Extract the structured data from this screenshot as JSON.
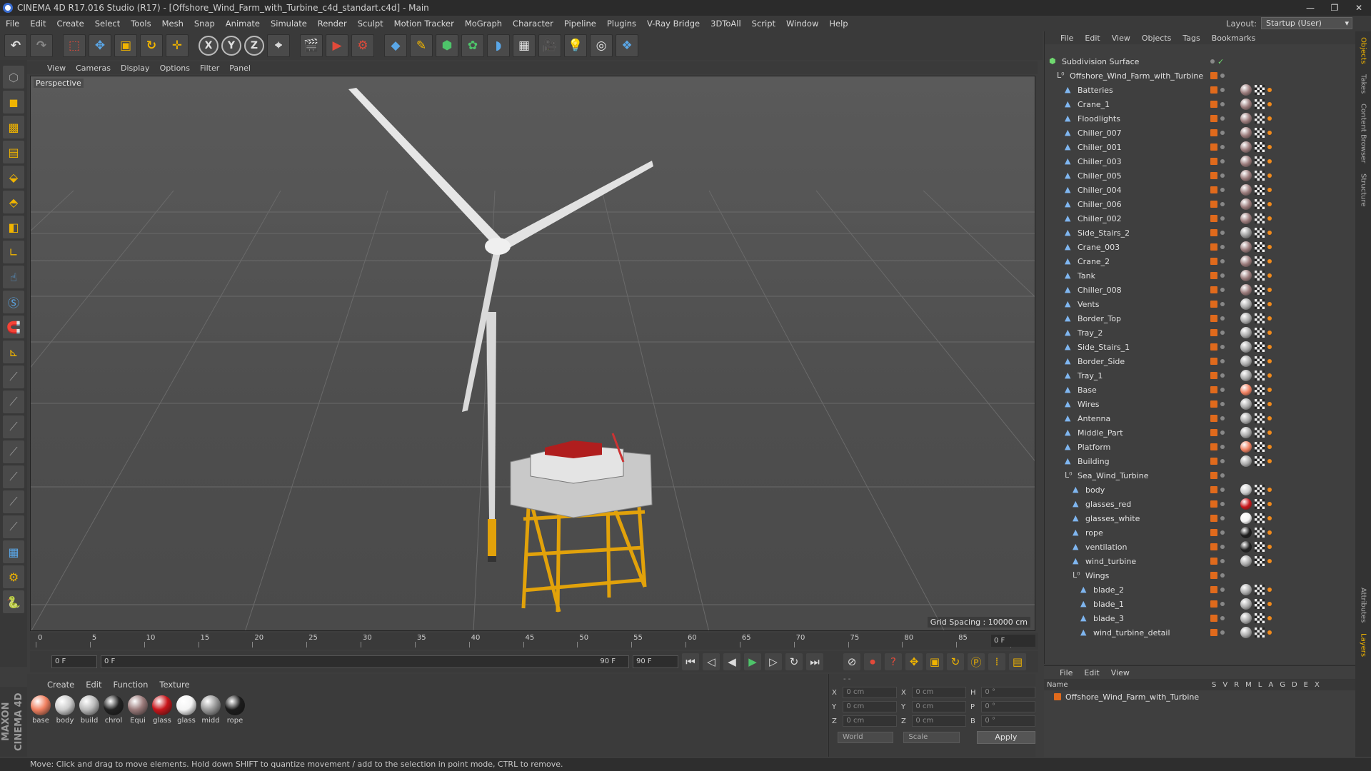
{
  "window": {
    "title": "CINEMA 4D R17.016 Studio (R17) - [Offshore_Wind_Farm_with_Turbine_c4d_standart.c4d] - Main",
    "controls": [
      "—",
      "❐",
      "✕"
    ]
  },
  "menubar": {
    "items": [
      "File",
      "Edit",
      "Create",
      "Select",
      "Tools",
      "Mesh",
      "Snap",
      "Animate",
      "Simulate",
      "Render",
      "Sculpt",
      "Motion Tracker",
      "MoGraph",
      "Character",
      "Pipeline",
      "Plugins",
      "V-Ray Bridge",
      "3DToAll",
      "Script",
      "Window",
      "Help"
    ],
    "layout_label": "Layout:",
    "layout_value": "Startup (User)"
  },
  "toolbar": {
    "axis_x": "X",
    "axis_y": "Y",
    "axis_z": "Z"
  },
  "viewport": {
    "menu": [
      "View",
      "Cameras",
      "Display",
      "Options",
      "Filter",
      "Panel"
    ],
    "label": "Perspective",
    "grid_spacing": "Grid Spacing : 10000 cm"
  },
  "timeline": {
    "ticks": [
      "0",
      "5",
      "10",
      "15",
      "20",
      "25",
      "30",
      "35",
      "40",
      "45",
      "50",
      "55",
      "60",
      "65",
      "70",
      "75",
      "80",
      "85",
      "90"
    ],
    "current_frame": "0 F",
    "start_field": "0 F",
    "range_start": "0 F",
    "range_end": "90 F",
    "end_field": "90 F"
  },
  "materials": {
    "menu": [
      "Create",
      "Edit",
      "Function",
      "Texture"
    ],
    "items": [
      {
        "name": "base",
        "color": "#f08060"
      },
      {
        "name": "body",
        "color": "#cccccc"
      },
      {
        "name": "build",
        "color": "#bbbbbb"
      },
      {
        "name": "chrol",
        "color": "#222222"
      },
      {
        "name": "Equi",
        "color": "#9a7a7a"
      },
      {
        "name": "glass",
        "color": "#c8151a"
      },
      {
        "name": "glass",
        "color": "#f4f4f4"
      },
      {
        "name": "midd",
        "color": "#999999"
      },
      {
        "name": "rope",
        "color": "#1c1c1c"
      }
    ]
  },
  "coordinates": {
    "rows": [
      {
        "a": "X",
        "av": "0 cm",
        "b": "X",
        "bv": "0 cm",
        "c": "H",
        "cv": "0 °"
      },
      {
        "a": "Y",
        "av": "0 cm",
        "b": "Y",
        "bv": "0 cm",
        "c": "P",
        "cv": "0 °"
      },
      {
        "a": "Z",
        "av": "0 cm",
        "b": "Z",
        "bv": "0 cm",
        "c": "B",
        "cv": "0 °"
      }
    ],
    "mode": "World",
    "scale": "Scale",
    "apply": "Apply"
  },
  "status": "Move: Click and drag to move elements. Hold down SHIFT to quantize movement / add to the selection in point mode, CTRL to remove.",
  "maxon": "MAXON CINEMA 4D",
  "objects": {
    "menu": [
      "File",
      "Edit",
      "View",
      "Objects",
      "Tags",
      "Bookmarks"
    ],
    "rows": [
      {
        "name": "Subdivision Surface",
        "level": 0,
        "tag": "none",
        "type": "subd"
      },
      {
        "name": "Offshore_Wind_Farm_with_Turbine",
        "level": 1,
        "tag": "none",
        "type": "null"
      },
      {
        "name": "Batteries",
        "level": 2,
        "tag": "#9a7a7a",
        "type": "poly"
      },
      {
        "name": "Crane_1",
        "level": 2,
        "tag": "#9a7a7a",
        "type": "poly"
      },
      {
        "name": "Floodlights",
        "level": 2,
        "tag": "#9a7a7a",
        "type": "poly"
      },
      {
        "name": "Chiller_007",
        "level": 2,
        "tag": "#9a7a7a",
        "type": "poly"
      },
      {
        "name": "Chiller_001",
        "level": 2,
        "tag": "#9a7a7a",
        "type": "poly"
      },
      {
        "name": "Chiller_003",
        "level": 2,
        "tag": "#9a7a7a",
        "type": "poly"
      },
      {
        "name": "Chiller_005",
        "level": 2,
        "tag": "#9a7a7a",
        "type": "poly"
      },
      {
        "name": "Chiller_004",
        "level": 2,
        "tag": "#9a7a7a",
        "type": "poly"
      },
      {
        "name": "Chiller_006",
        "level": 2,
        "tag": "#9a7a7a",
        "type": "poly"
      },
      {
        "name": "Chiller_002",
        "level": 2,
        "tag": "#9a7a7a",
        "type": "poly"
      },
      {
        "name": "Side_Stairs_2",
        "level": 2,
        "tag": "#9a9a9a",
        "type": "poly"
      },
      {
        "name": "Crane_003",
        "level": 2,
        "tag": "#9a7a7a",
        "type": "poly"
      },
      {
        "name": "Crane_2",
        "level": 2,
        "tag": "#9a7a7a",
        "type": "poly"
      },
      {
        "name": "Tank",
        "level": 2,
        "tag": "#9a7a7a",
        "type": "poly"
      },
      {
        "name": "Chiller_008",
        "level": 2,
        "tag": "#9a7a7a",
        "type": "poly"
      },
      {
        "name": "Vents",
        "level": 2,
        "tag": "#aaaaaa",
        "type": "poly"
      },
      {
        "name": "Border_Top",
        "level": 2,
        "tag": "#aaaaaa",
        "type": "poly"
      },
      {
        "name": "Tray_2",
        "level": 2,
        "tag": "#aaaaaa",
        "type": "poly"
      },
      {
        "name": "Side_Stairs_1",
        "level": 2,
        "tag": "#aaaaaa",
        "type": "poly"
      },
      {
        "name": "Border_Side",
        "level": 2,
        "tag": "#aaaaaa",
        "type": "poly"
      },
      {
        "name": "Tray_1",
        "level": 2,
        "tag": "#aaaaaa",
        "type": "poly"
      },
      {
        "name": "Base",
        "level": 2,
        "tag": "#f08060",
        "type": "poly"
      },
      {
        "name": "Wires",
        "level": 2,
        "tag": "#aaaaaa",
        "type": "poly"
      },
      {
        "name": "Antenna",
        "level": 2,
        "tag": "#aaaaaa",
        "type": "poly"
      },
      {
        "name": "Middle_Part",
        "level": 2,
        "tag": "#aaaaaa",
        "type": "poly"
      },
      {
        "name": "Platform",
        "level": 2,
        "tag": "#f08060",
        "type": "poly"
      },
      {
        "name": "Building",
        "level": 2,
        "tag": "#aaaaaa",
        "type": "poly"
      },
      {
        "name": "Sea_Wind_Turbine",
        "level": 2,
        "tag": "none",
        "type": "null"
      },
      {
        "name": "body",
        "level": 3,
        "tag": "#cccccc",
        "type": "poly"
      },
      {
        "name": "glasses_red",
        "level": 3,
        "tag": "#c8151a",
        "type": "poly"
      },
      {
        "name": "glasses_white",
        "level": 3,
        "tag": "#f4f4f4",
        "type": "poly"
      },
      {
        "name": "rope",
        "level": 3,
        "tag": "#1c1c1c",
        "type": "poly"
      },
      {
        "name": "ventilation",
        "level": 3,
        "tag": "#222222",
        "type": "poly"
      },
      {
        "name": "wind_turbine",
        "level": 3,
        "tag": "#aaaaaa",
        "type": "poly"
      },
      {
        "name": "Wings",
        "level": 3,
        "tag": "none",
        "type": "null"
      },
      {
        "name": "blade_2",
        "level": 4,
        "tag": "#aaaaaa",
        "type": "poly"
      },
      {
        "name": "blade_1",
        "level": 4,
        "tag": "#aaaaaa",
        "type": "poly"
      },
      {
        "name": "blade_3",
        "level": 4,
        "tag": "#aaaaaa",
        "type": "poly"
      },
      {
        "name": "wind_turbine_detail",
        "level": 4,
        "tag": "#aaaaaa",
        "type": "poly"
      }
    ]
  },
  "layers": {
    "menu": [
      "File",
      "Edit",
      "View"
    ],
    "header_name": "Name",
    "cols": [
      "S",
      "V",
      "R",
      "M",
      "L",
      "A",
      "G",
      "D",
      "E",
      "X"
    ],
    "row": "Offshore_Wind_Farm_with_Turbine"
  },
  "sidetabs": [
    "Objects",
    "Takes",
    "Content Browser",
    "Structure",
    "Attributes",
    "Layers"
  ]
}
